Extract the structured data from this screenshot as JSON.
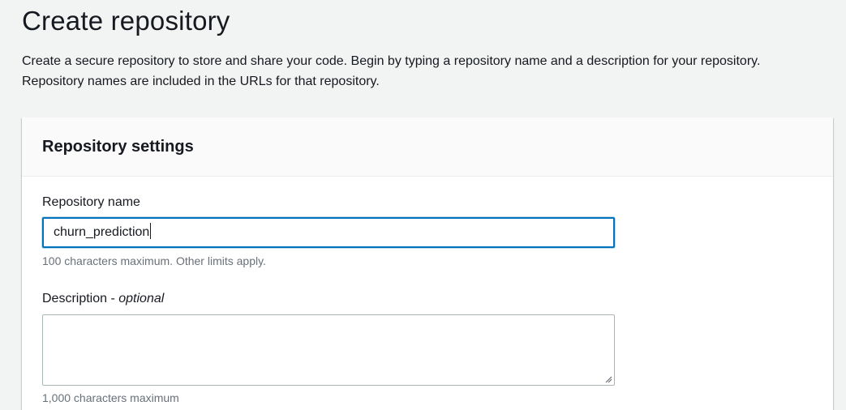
{
  "page": {
    "title": "Create repository",
    "description": "Create a secure repository to store and share your code. Begin by typing a repository name and a description for your repository. Repository names are included in the URLs for that repository."
  },
  "settings": {
    "title": "Repository settings",
    "repo_name": {
      "label": "Repository name",
      "value": "churn_prediction",
      "constraint": "100 characters maximum. Other limits apply."
    },
    "description": {
      "label": "Description",
      "optional_separator": " - ",
      "optional_label": "optional",
      "value": "",
      "constraint": "1,000 characters maximum"
    }
  },
  "colors": {
    "background": "#f2f3f3",
    "focus_border": "#0073bb",
    "input_border": "#aab7b8",
    "constraint_text": "#687078"
  },
  "icons": {
    "resize_handle": "resize-handle-icon"
  }
}
